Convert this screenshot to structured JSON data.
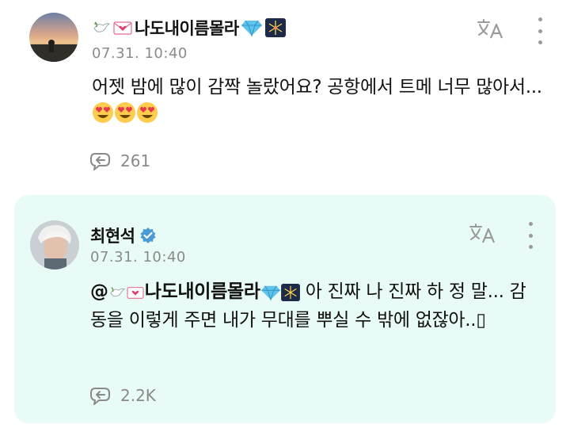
{
  "posts": [
    {
      "author": "나도내이름몰라",
      "timestamp": "07.31. 10:40",
      "body": "어젯 밤에 많이 감짝 놀랐어요? 공항에서 트메 너무 많아서...",
      "emojis": [
        "heart-eyes",
        "heart-eyes",
        "heart-eyes"
      ],
      "reply_count": "261",
      "verified": false
    },
    {
      "author": "최현석",
      "timestamp": "07.31. 10:40",
      "mention_prefix": "@",
      "mention_name": "나도내이름몰라",
      "body_line1": "아 진짜 나 진짜 하 정",
      "body_rest": "말... 감동을 이렇게 주면 내가 무대를 뿌실 수 밖에 없잖아..",
      "unknown_glyph": "▯",
      "reply_count": "2.2K",
      "verified": true
    }
  ],
  "icons": {
    "translate": "translate-icon",
    "more": "more-vertical-icon",
    "reply": "reply-bubble-icon"
  },
  "colors": {
    "highlight_bg": "#e9fbf6",
    "verified": "#4a9bd6",
    "muted": "#8a8a8a"
  }
}
